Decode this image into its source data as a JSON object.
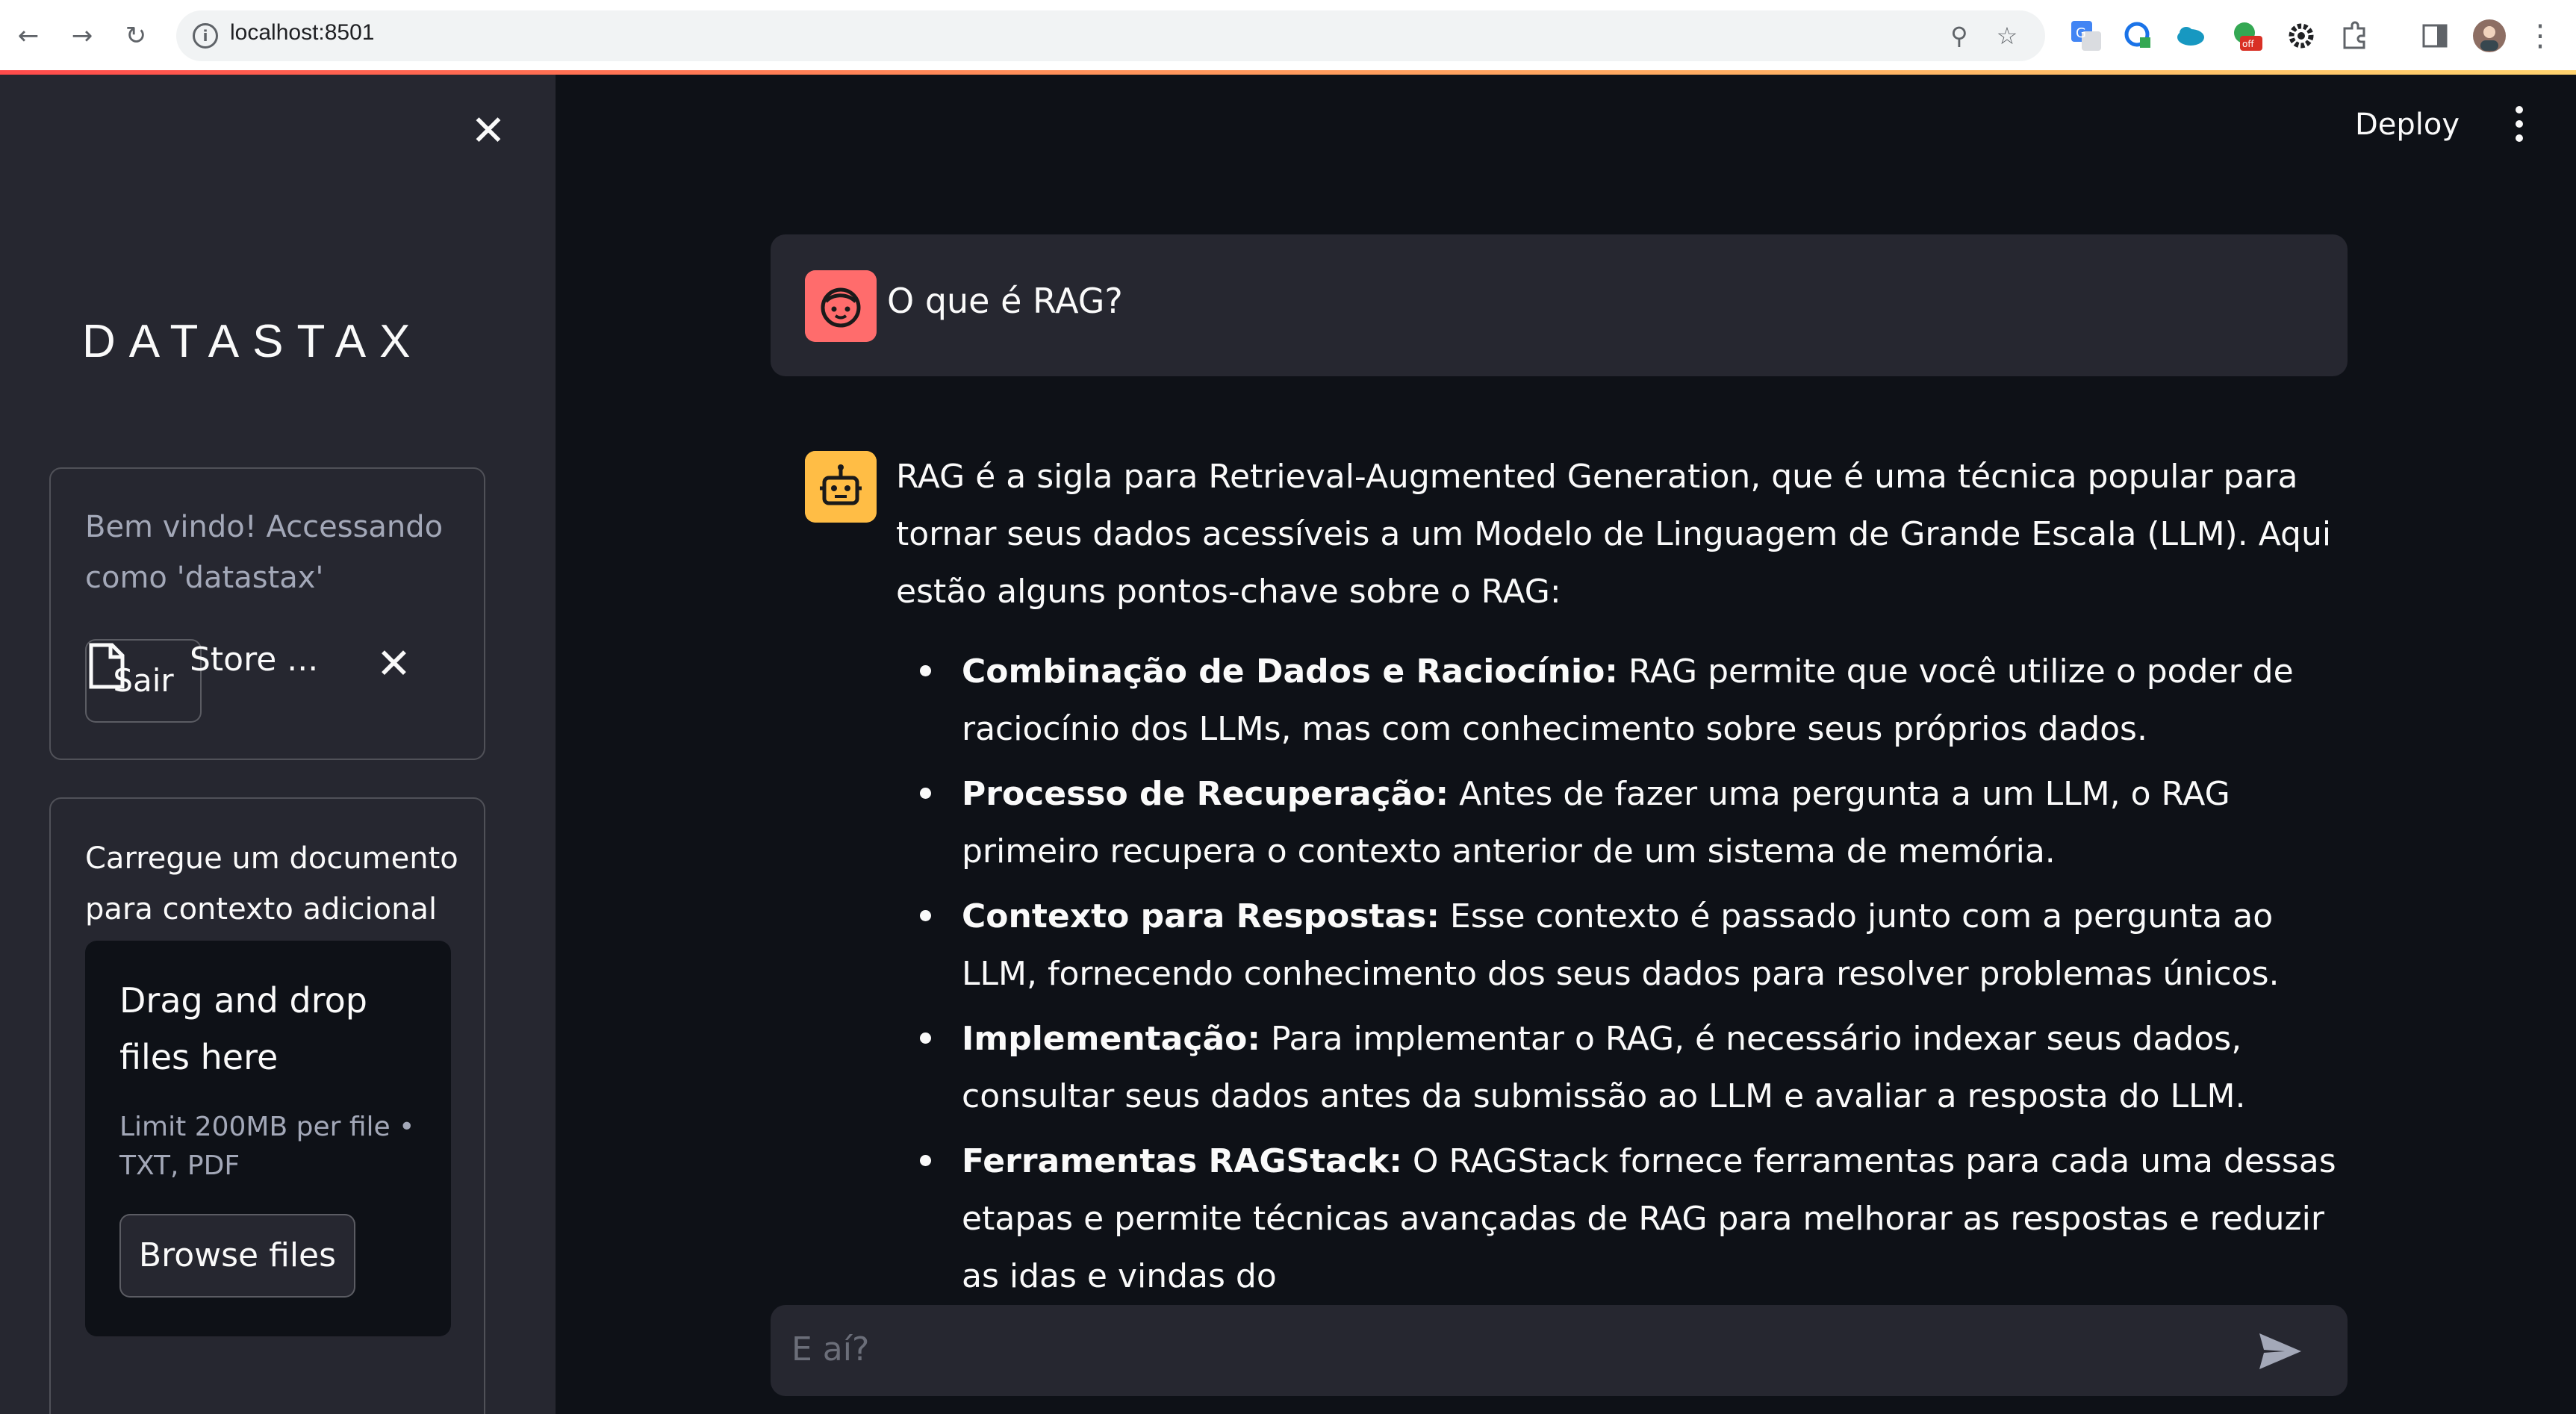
{
  "browser": {
    "url": "localhost:8501"
  },
  "sidebar": {
    "logo": "DATASTAX",
    "welcome_text": "Bem vindo! Accessando como 'datastax'",
    "signout_label": "Sair",
    "upload_label": "Carregue um documento para contexto adicional",
    "dropzone_title": "Drag and drop files here",
    "dropzone_limit": "Limit 200MB per file • TXT, PDF",
    "browse_label": "Browse files",
    "file_name": "Store ..."
  },
  "header": {
    "deploy_label": "Deploy"
  },
  "chat": {
    "user_message": "O que é RAG?",
    "bot_intro": "RAG é a sigla para Retrieval-Augmented Generation, que é uma técnica popular para tornar seus dados acessíveis a um Modelo de Linguagem de Grande Escala (LLM). Aqui estão alguns pontos-chave sobre o RAG:",
    "bot_points": [
      {
        "title": "Combinação de Dados e Raciocínio:",
        "text": " RAG permite que você utilize o poder de raciocínio dos LLMs, mas com conhecimento sobre seus próprios dados."
      },
      {
        "title": "Processo de Recuperação:",
        "text": " Antes de fazer uma pergunta a um LLM, o RAG primeiro recupera o contexto anterior de um sistema de memória."
      },
      {
        "title": "Contexto para Respostas:",
        "text": " Esse contexto é passado junto com a pergunta ao LLM, fornecendo conhecimento dos seus dados para resolver problemas únicos."
      },
      {
        "title": "Implementação:",
        "text": " Para implementar o RAG, é necessário indexar seus dados, consultar seus dados antes da submissão ao LLM e avaliar a resposta do LLM."
      },
      {
        "title": "Ferramentas RAGStack:",
        "text": " O RAGStack fornece ferramentas para cada uma dessas etapas e permite técnicas avançadas de RAG para melhorar as respostas e reduzir as idas e vindas do"
      }
    ],
    "input_placeholder": "E aí?"
  },
  "colors": {
    "sidebar_bg": "#262730",
    "main_bg": "#0e1117",
    "user_avatar": "#ff6c6c",
    "bot_avatar": "#ffbd45",
    "accent_line": "#ff4b4b"
  },
  "icons": {
    "back": "arrow-left-icon",
    "forward": "arrow-right-icon",
    "reload": "reload-icon",
    "close": "close-icon",
    "file": "file-icon",
    "send": "send-icon",
    "menu": "kebab-menu-icon"
  }
}
